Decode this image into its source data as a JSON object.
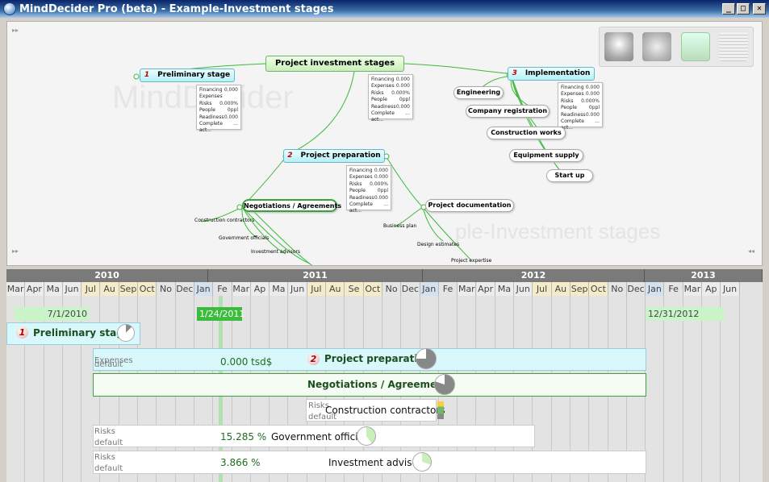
{
  "window": {
    "title": "MindDecider Pro (beta) - Example-Investment stages",
    "min_label": "_",
    "max_label": "□",
    "close_label": "✕"
  },
  "map": {
    "watermark_brand": "MindDecider",
    "watermark_title": "ple-Investment stages",
    "root": "Project investment stages",
    "stages": [
      {
        "num": "1",
        "label": "Preliminary stage"
      },
      {
        "num": "2",
        "label": "Project preparation"
      },
      {
        "num": "3",
        "label": "Implementation"
      }
    ],
    "props": {
      "labels": [
        "Financing",
        "Expenses",
        "Risks",
        "People",
        "Readiness",
        "Complete act..."
      ],
      "preliminary": [
        "0.000",
        "",
        "0.000%",
        "0ppl",
        "0.000",
        "..."
      ],
      "root": [
        "0.000",
        "0.000",
        "0.000%",
        "0ppl",
        "0.000",
        "..."
      ],
      "preparation": [
        "0.000",
        "0.000",
        "0.000%",
        "0ppl",
        "0.000",
        "..."
      ],
      "implementation": [
        "0.000",
        "0.000",
        "0.000%",
        "0ppl",
        "0.000",
        "..."
      ]
    },
    "impl_children": [
      "Engineering",
      "Company registration",
      "Construction works",
      "Equipment supply",
      "Start up"
    ],
    "prep_children": [
      "Negotiations / Agreements",
      "Project documentation"
    ],
    "nego_children": [
      "Construction contractors",
      "Government officials",
      "Investment advisors"
    ],
    "doc_children": [
      "Business plan",
      "Design estimates",
      "Project expertise"
    ],
    "toolbar_icons": [
      "cloud-icon",
      "coins-icon",
      "hourglass-icon",
      "document-icon"
    ]
  },
  "gantt": {
    "years": [
      "2010",
      "2011",
      "2012",
      "2013"
    ],
    "months": [
      "Mar",
      "Apr",
      "May",
      "Jun",
      "Jul",
      "Aug",
      "Sep",
      "Oct",
      "Nov",
      "Dec",
      "Jan",
      "Feb",
      "Mar",
      "Apr",
      "May",
      "Jun",
      "Jul",
      "Aug",
      "Sep",
      "Oct",
      "Nov",
      "Dec",
      "Jan",
      "Feb",
      "Mar",
      "Apr",
      "May",
      "Jun",
      "Jul",
      "Aug",
      "Sep",
      "Oct",
      "Nov",
      "Dec",
      "Jan",
      "Feb",
      "Mar",
      "Apr",
      "May",
      "Jun"
    ],
    "month_labels": [
      "Mar",
      "Apr",
      "Ma",
      "Jun",
      "Jul",
      "Au",
      "Sep",
      "Oct",
      "No",
      "Dec",
      "Jan",
      "Fe",
      "Mar",
      "Ap",
      "Ma",
      "Jun",
      "Jul",
      "Au",
      "Se",
      "Oct",
      "No",
      "Dec",
      "Jan",
      "Fe",
      "Mar",
      "Apr",
      "Ma",
      "Jun",
      "Jul",
      "Au",
      "Sep",
      "Oct",
      "No",
      "Dec",
      "Jan",
      "Fe",
      "Mar",
      "Ap",
      "Jun"
    ],
    "dates": {
      "start": "7/1/2010",
      "today": "1/24/2011",
      "end": "12/31/2012"
    },
    "tasks": [
      {
        "num": "1",
        "name": "Preliminary stage"
      },
      {
        "num": "2",
        "name": "Project preparation",
        "expenses_label": "Expenses",
        "default_label": "default",
        "value": "0.000 tsd$"
      },
      {
        "name": "Negotiations / Agreements"
      },
      {
        "name": "Construction contractors",
        "risks_label": "Risks",
        "default_label": "default"
      },
      {
        "name": "Government officials",
        "risks_label": "Risks",
        "default_label": "default",
        "value": "15.285 %"
      },
      {
        "name": "Investment advisors",
        "risks_label": "Risks",
        "default_label": "default",
        "value": "3.866 %"
      }
    ]
  },
  "colors": {
    "stage_fill": "#b8f0f8",
    "root_fill": "#c8f0b8",
    "accent_green": "#3ca03c",
    "year_header": "#7a7a7a"
  }
}
